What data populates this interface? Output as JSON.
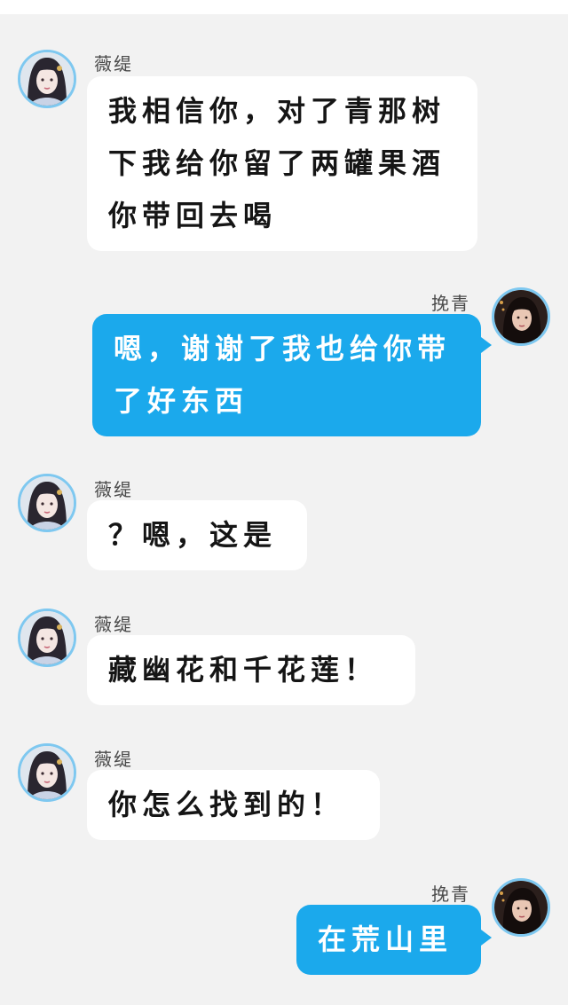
{
  "participants": {
    "other": {
      "name": "薇缇"
    },
    "me": {
      "name": "挽青"
    }
  },
  "messages": [
    {
      "side": "in",
      "sender": "薇缇",
      "text": "我相信你，对了青那树下我给你留了两罐果酒你带回去喝"
    },
    {
      "side": "out",
      "sender": "挽青",
      "text": "嗯，谢谢了我也给你带了好东西"
    },
    {
      "side": "in",
      "sender": "薇缇",
      "text": "？嗯，这是"
    },
    {
      "side": "in",
      "sender": "薇缇",
      "text": "藏幽花和千花莲！"
    },
    {
      "side": "in",
      "sender": "薇缇",
      "text": "你怎么找到的！"
    },
    {
      "side": "out",
      "sender": "挽青",
      "text": "在荒山里"
    }
  ],
  "avatars": {
    "other": "avatar-painted-woman-icon",
    "me": "avatar-photo-woman-icon"
  },
  "colors": {
    "background": "#f2f2f2",
    "incoming_bubble": "#ffffff",
    "outgoing_bubble": "#1ba9ec",
    "avatar_ring": "#7ec8f0"
  }
}
